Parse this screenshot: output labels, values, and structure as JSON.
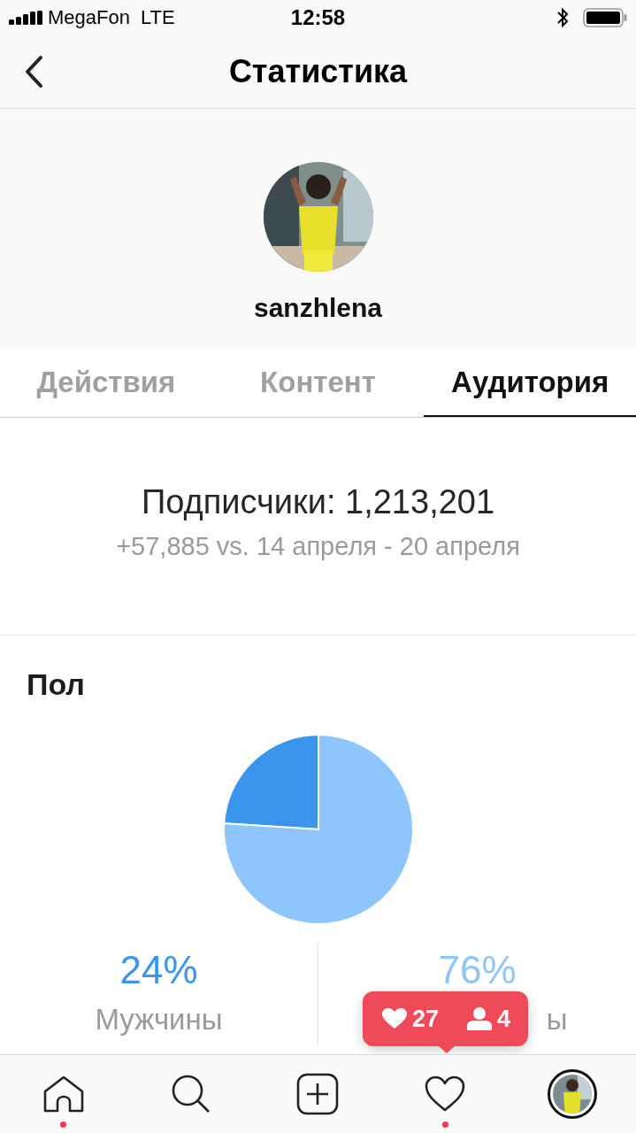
{
  "status_bar": {
    "carrier": "MegaFon",
    "network": "LTE",
    "time": "12:58"
  },
  "nav": {
    "title": "Статистика"
  },
  "profile": {
    "username": "sanzhlena"
  },
  "tabs": [
    {
      "label": "Действия",
      "selected": false
    },
    {
      "label": "Контент",
      "selected": false
    },
    {
      "label": "Аудитория",
      "selected": true
    }
  ],
  "followers": {
    "title": "Подписчики: 1,213,201",
    "change": "+57,885 vs. 14 апреля - 20 апреля"
  },
  "gender": {
    "title": "Пол",
    "chart_data": {
      "type": "pie",
      "values": [
        24,
        76
      ]
    },
    "items": [
      {
        "percent": "24%",
        "label": "Мужчины",
        "color": "#3a96ec"
      },
      {
        "percent": "76%",
        "label": "ы",
        "color": "#8ec5fb"
      }
    ]
  },
  "activity_popup": {
    "likes": "27",
    "follows": "4"
  },
  "tab_bar": [
    {
      "kind": "home",
      "dot": true
    },
    {
      "kind": "search",
      "dot": false
    },
    {
      "kind": "add",
      "dot": false
    },
    {
      "kind": "activity",
      "dot": true
    },
    {
      "kind": "profile",
      "dot": false
    }
  ]
}
